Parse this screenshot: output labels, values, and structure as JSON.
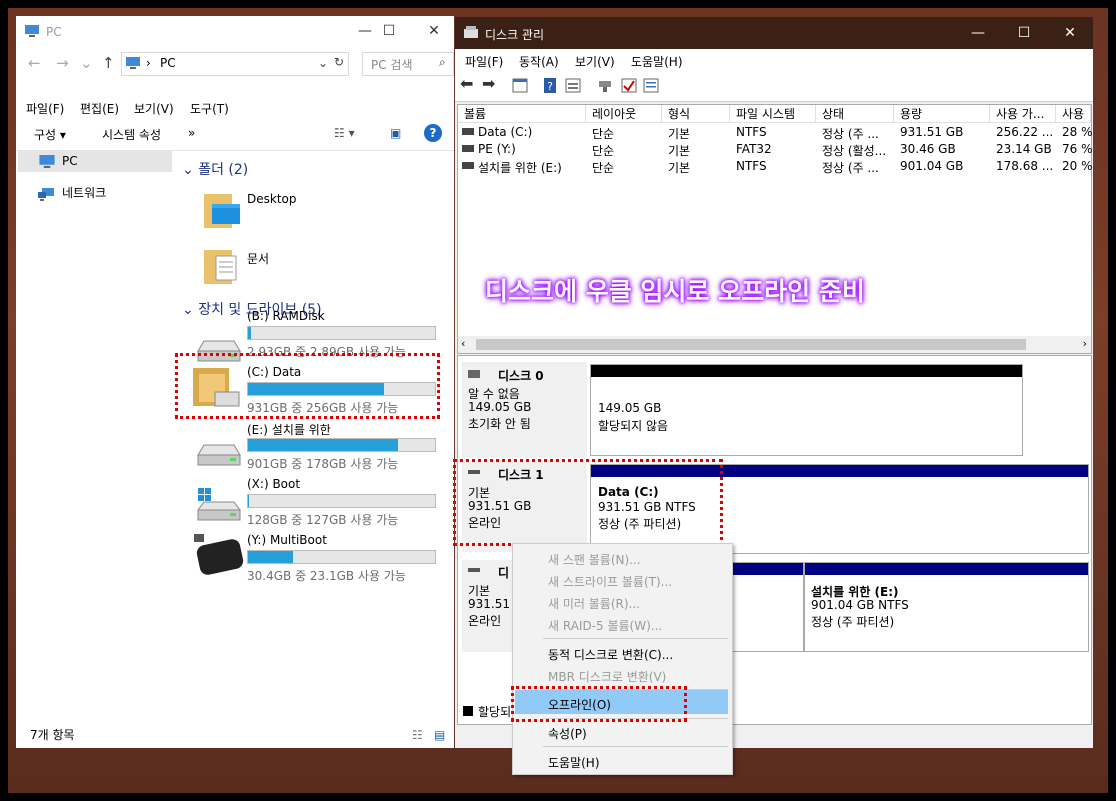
{
  "explorer": {
    "title": "PC",
    "address": "PC",
    "search_placeholder": "PC 검색",
    "menu": [
      "파일(F)",
      "편집(E)",
      "보기(V)",
      "도구(T)"
    ],
    "toolbar": {
      "organize": "구성",
      "system_props": "시스템 속성",
      "more": "»"
    },
    "nav": [
      {
        "label": "PC",
        "icon": "computer-icon",
        "selected": true
      },
      {
        "label": "네트워크",
        "icon": "network-icon",
        "selected": false
      }
    ],
    "groups": {
      "folders": "폴더 (2)",
      "devices": "장치 및 드라이브 (5)"
    },
    "folders": [
      {
        "name": "Desktop",
        "icon": "desktop-folder-icon"
      },
      {
        "name": "문서",
        "icon": "documents-folder-icon"
      }
    ],
    "drives": [
      {
        "name": "(B:) RAMDisk",
        "free": "2.93GB 중 2.89GB 사용 가능",
        "used_fraction": 0.014
      },
      {
        "name": "(C:) Data",
        "free": "931GB 중 256GB 사용 가능",
        "used_fraction": 0.725
      },
      {
        "name": "(E:) 설치를 위한",
        "free": "901GB 중 178GB 사용 가능",
        "used_fraction": 0.802
      },
      {
        "name": "(X:) Boot",
        "free": "128GB 중 127GB 사용 가능",
        "used_fraction": 0.008
      },
      {
        "name": "(Y:) MultiBoot",
        "free": "30.4GB 중 23.1GB 사용 가능",
        "used_fraction": 0.24
      }
    ],
    "status": "7개 항목"
  },
  "diskmgmt": {
    "title": "디스크 관리",
    "menu": [
      "파일(F)",
      "동작(A)",
      "보기(V)",
      "도움말(H)"
    ],
    "columns": [
      "볼륨",
      "레이아웃",
      "형식",
      "파일 시스템",
      "상태",
      "용량",
      "사용 가...",
      "사용"
    ],
    "volumes": [
      [
        "Data (C:)",
        "단순",
        "기본",
        "NTFS",
        "정상 (주 ...",
        "931.51 GB",
        "256.22 ...",
        "28 %"
      ],
      [
        "PE (Y:)",
        "단순",
        "기본",
        "FAT32",
        "정상 (활성...",
        "30.46 GB",
        "23.14 GB",
        "76 %"
      ],
      [
        "설치를 위한 (E:)",
        "단순",
        "기본",
        "NTFS",
        "정상 (주 ...",
        "901.04 GB",
        "178.68 ...",
        "20 %"
      ]
    ],
    "overlay_text": "디스크에 우클 임시로 오프라인 준비",
    "disks": [
      {
        "name": "디스크 0",
        "lines": [
          "알 수 없음",
          "149.05 GB",
          "초기화 안 됨"
        ],
        "partitions": [
          {
            "title": "",
            "lines": [
              "149.05 GB",
              "할당되지 않음"
            ]
          }
        ]
      },
      {
        "name": "디스크 1",
        "lines": [
          "기본",
          "931.51 GB",
          "온라인"
        ],
        "partitions": [
          {
            "title": "Data  (C:)",
            "lines": [
              "931.51 GB NTFS",
              "정상 (주 파티션)"
            ]
          }
        ]
      },
      {
        "name": "디",
        "lines": [
          "기본",
          "931.51 G",
          "온라인"
        ],
        "partitions": [
          {
            "title": "설치를 위한  (E:)",
            "lines": [
              "901.04 GB NTFS",
              "정상 (주 파티션)"
            ]
          }
        ]
      }
    ],
    "legend": "할당되"
  },
  "context_menu": [
    {
      "label": "새 스팬 볼륨(N)...",
      "enabled": false
    },
    {
      "label": "새 스트라이프 볼륨(T)...",
      "enabled": false
    },
    {
      "label": "새 미러 볼륨(R)...",
      "enabled": false
    },
    {
      "label": "새 RAID-5 볼륨(W)...",
      "enabled": false
    },
    {
      "label": "동적 디스크로 변환(C)...",
      "enabled": true
    },
    {
      "label": "MBR 디스크로 변환(V)",
      "enabled": false
    },
    {
      "label": "오프라인(O)",
      "enabled": true,
      "highlighted": true
    },
    {
      "label": "속성(P)",
      "enabled": true
    },
    {
      "label": "도움말(H)",
      "enabled": true
    }
  ],
  "colors": {
    "accent": "#26a0da",
    "titlebar_dm": "#3b2015",
    "annotation": "#e00000",
    "partition_header": "#000080"
  }
}
